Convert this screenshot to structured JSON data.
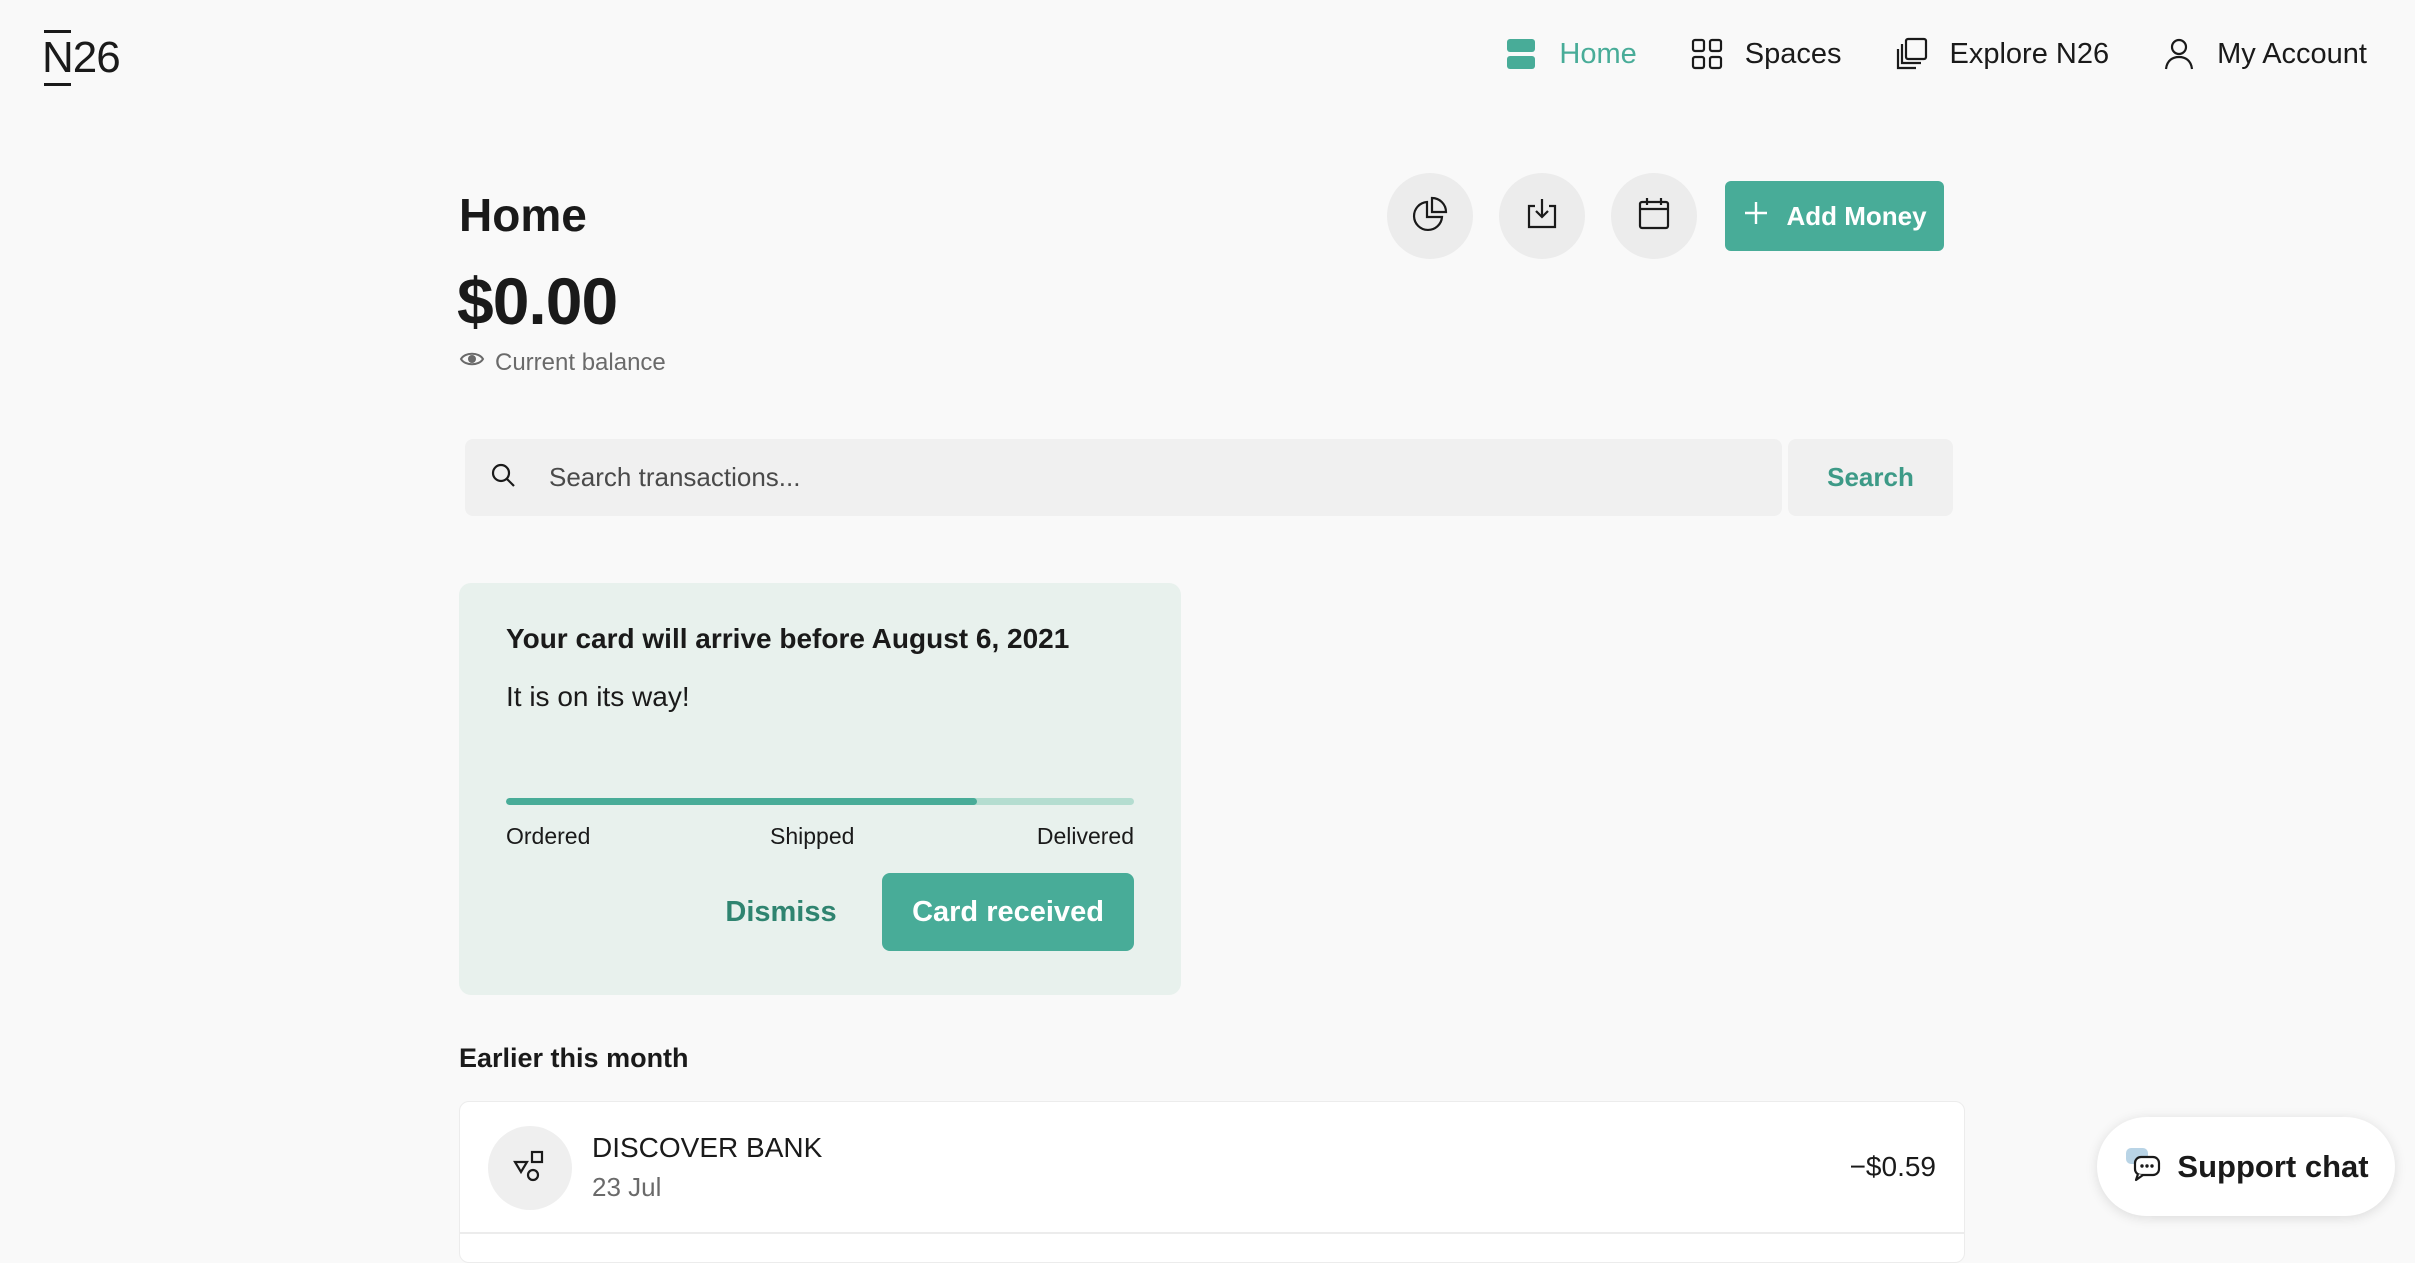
{
  "brand": {
    "logo_text": "N26",
    "accent_color": "#48ac98"
  },
  "nav": {
    "items": [
      {
        "label": "Home",
        "icon": "home-icon",
        "active": true
      },
      {
        "label": "Spaces",
        "icon": "spaces-icon",
        "active": false
      },
      {
        "label": "Explore N26",
        "icon": "explore-icon",
        "active": false
      },
      {
        "label": "My Account",
        "icon": "account-icon",
        "active": false
      }
    ]
  },
  "header": {
    "title": "Home",
    "balance": "$0.00",
    "balance_label": "Current balance",
    "actions": [
      {
        "icon": "statistics-pie-chart-icon"
      },
      {
        "icon": "download-icon"
      },
      {
        "icon": "calendar-icon"
      }
    ],
    "add_money_label": "Add Money"
  },
  "search": {
    "placeholder": "Search transactions...",
    "value": "",
    "button_label": "Search"
  },
  "card_status": {
    "title": "Your card will arrive before August 6, 2021",
    "subtitle": "It is on its way!",
    "progress_fraction": 0.75,
    "steps": [
      "Ordered",
      "Shipped",
      "Delivered"
    ],
    "dismiss_label": "Dismiss",
    "received_label": "Card received"
  },
  "transactions": {
    "section_title": "Earlier this month",
    "items": [
      {
        "name": "DISCOVER BANK",
        "date": "23 Jul",
        "amount": "−$0.59",
        "icon": "transfer-shapes-icon"
      }
    ]
  },
  "support": {
    "label": "Support chat",
    "icon": "chat-bubbles-icon"
  }
}
